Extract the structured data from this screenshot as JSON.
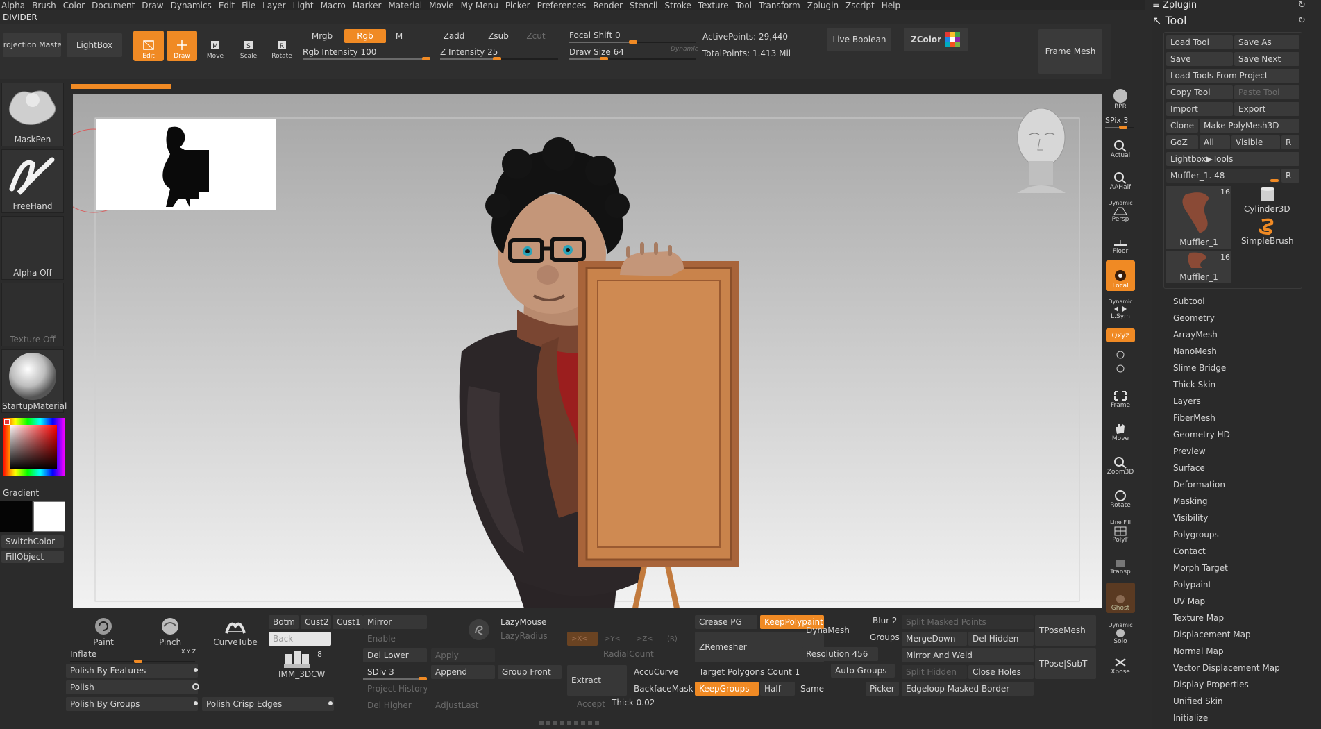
{
  "menu": [
    "Alpha",
    "Brush",
    "Color",
    "Document",
    "Draw",
    "Dynamics",
    "Edit",
    "File",
    "Layer",
    "Light",
    "Macro",
    "Marker",
    "Material",
    "Movie",
    "My Menu",
    "Picker",
    "Preferences",
    "Render",
    "Stencil",
    "Stroke",
    "Texture",
    "Tool",
    "Transform",
    "Zplugin",
    "Zscript",
    "Help"
  ],
  "divider": "DIVIDER",
  "top": {
    "projection_master": "Projection Master",
    "lightbox": "LightBox",
    "edit": "Edit",
    "draw": "Draw",
    "move": "Move",
    "scale": "Scale",
    "rotate": "Rotate",
    "mrgb": "Mrgb",
    "rgb": "Rgb",
    "m": "M",
    "zadd": "Zadd",
    "zsub": "Zsub",
    "zcut": "Zcut",
    "rgb_intensity": "Rgb Intensity 100",
    "z_intensity": "Z Intensity 25",
    "focal_shift": "Focal Shift 0",
    "draw_size": "Draw Size 64",
    "dynamic": "Dynamic",
    "active_points": "ActivePoints: 29,440",
    "total_points": "TotalPoints: 1.413 Mil",
    "live_boolean": "Live Boolean",
    "zcolor": "ZColor",
    "frame_mesh": "Frame Mesh"
  },
  "left": {
    "maskpen": "MaskPen",
    "freehand": "FreeHand",
    "alpha_off": "Alpha Off",
    "texture_off": "Texture Off",
    "material": "StartupMaterial",
    "gradient": "Gradient",
    "switch_color": "SwitchColor",
    "fill_object": "FillObject"
  },
  "shelf": {
    "bpr": "BPR",
    "spix": "SPix 3",
    "actual": "Actual",
    "aahalf": "AAHalf",
    "dynamic": "Dynamic",
    "persp": "Persp",
    "floor": "Floor",
    "local": "Local",
    "dynamic2": "Dynamic",
    "lsym": "L.Sym",
    "xyz": "Qxyz",
    "frame": "Frame",
    "move": "Move",
    "zoom3d": "Zoom3D",
    "rotate": "Rotate",
    "linefill": "Line Fill",
    "polyf": "PolyF",
    "transp": "Transp",
    "ghost": "Ghost",
    "dynamic3": "Dynamic",
    "solo": "Solo",
    "xpose": "Xpose"
  },
  "tray": {
    "zplugin": "Zplugin",
    "tool": "Tool",
    "load_tool": "Load Tool",
    "save_as": "Save As",
    "save": "Save",
    "save_next": "Save Next",
    "load_from_project": "Load Tools From Project",
    "copy_tool": "Copy Tool",
    "paste_tool": "Paste Tool",
    "import": "Import",
    "export": "Export",
    "clone": "Clone",
    "make_polymesh": "Make PolyMesh3D",
    "goz": "GoZ",
    "all": "All",
    "visible": "Visible",
    "r": "R",
    "lightbox_tools": "Lightbox▶Tools",
    "muffler_slider": "Muffler_1. 48",
    "r2": "R",
    "thumb1_count": "16",
    "thumb1_label": "Muffler_1",
    "cylinder": "Cylinder3D",
    "simplebrush": "SimpleBrush",
    "thumb2_count": "16",
    "thumb2_label": "Muffler_1",
    "sections": [
      "Subtool",
      "Geometry",
      "ArrayMesh",
      "NanoMesh",
      "Slime Bridge",
      "Thick Skin",
      "Layers",
      "FiberMesh",
      "Geometry HD",
      "Preview",
      "Surface",
      "Deformation",
      "Masking",
      "Visibility",
      "Polygroups",
      "Contact",
      "Morph Target",
      "Polypaint",
      "UV Map",
      "Texture Map",
      "Displacement Map",
      "Normal Map",
      "Vector Displacement Map",
      "Display Properties",
      "Unified Skin",
      "Initialize"
    ]
  },
  "bottom": {
    "paint": "Paint",
    "pinch": "Pinch",
    "curvetube": "CurveTube",
    "inflate": "Inflate",
    "inflate_xyz": "X Y Z",
    "polish_features": "Polish By Features",
    "polish": "Polish",
    "polish_groups": "Polish By Groups",
    "polish_crisp": "Polish Crisp Edges",
    "botm": "Botm",
    "cust2": "Cust2",
    "cust1": "Cust1",
    "back": "Back",
    "imm_count": "8",
    "imm": "IMM_3DCW",
    "mirror": "Mirror",
    "enable": "Enable",
    "del_lower": "Del Lower",
    "sdiv": "SDiv 3",
    "project_history": "Project History",
    "del_higher": "Del Higher",
    "lazymouse": "LazyMouse",
    "lazyradius": "LazyRadius",
    "apply": "Apply",
    "append": "Append",
    "group_front": "Group Front",
    "adjustlast": "AdjustLast",
    "sym_x": ">X<",
    "sym_y": ">Y<",
    "sym_z": ">Z<",
    "sym_r": "(R)",
    "radialcount": "RadialCount",
    "extract": "Extract",
    "accucurve": "AccuCurve",
    "backfacemask": "BackfaceMask",
    "accept": "Accept",
    "thick": "Thick 0.02",
    "crease_pg": "Crease PG",
    "keep_polypaint": "KeepPolypaint",
    "zremesher": "ZRemesher",
    "target_polygons": "Target Polygons Count 1",
    "keepgroups": "KeepGroups",
    "half": "Half",
    "same": "Same",
    "dynamesh": "DynaMesh",
    "resolution": "Resolution 456",
    "blur": "Blur 2",
    "groups": "Groups",
    "auto_groups": "Auto Groups",
    "picker": "Picker",
    "split_masked": "Split Masked Points",
    "mergedown": "MergeDown",
    "del_hidden": "Del Hidden",
    "mirror_weld": "Mirror And Weld",
    "split_hidden": "Split Hidden",
    "close_holes": "Close Holes",
    "edgeloop": "Edgeloop Masked Border",
    "tposemesh": "TPoseMesh",
    "tpose_subt": "TPose|SubT"
  },
  "colors": {
    "accent": "#f08a24",
    "panel": "#2b2b2b",
    "button": "#3a3a3a",
    "canvas_top": "#a6a6a6",
    "canvas_bottom": "#f2f2f2",
    "board": "#c9834b",
    "scarf": "#7a4632",
    "jacket": "#2c2628"
  }
}
